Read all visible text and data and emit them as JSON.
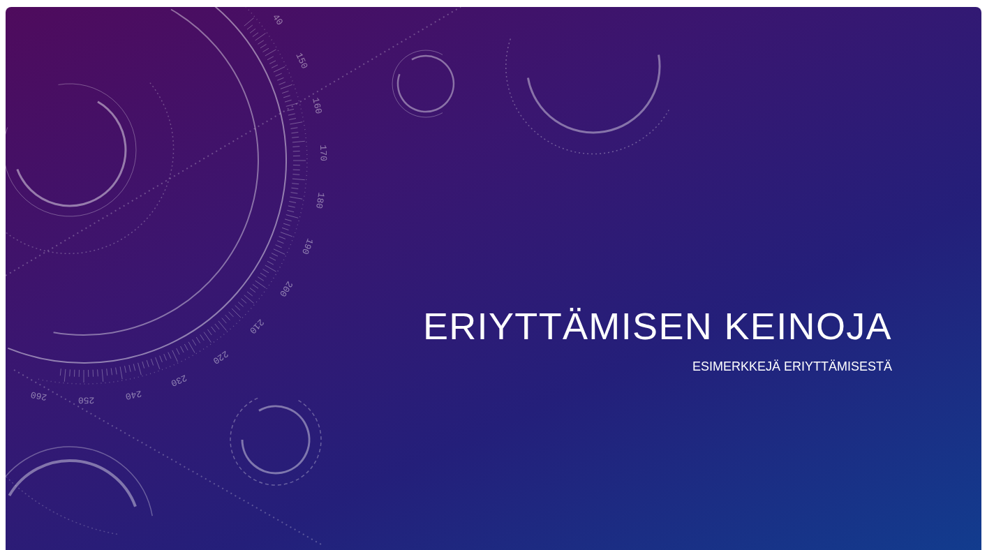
{
  "slide": {
    "title": "ERIYTTÄMISEN KEINOJA",
    "subtitle": "ESIMERKKEJÄ ERIYTTÄMISESTÄ",
    "dial_labels": [
      "40",
      "150",
      "160",
      "170",
      "180",
      "190",
      "200",
      "210",
      "220",
      "230",
      "240",
      "250",
      "260"
    ]
  }
}
